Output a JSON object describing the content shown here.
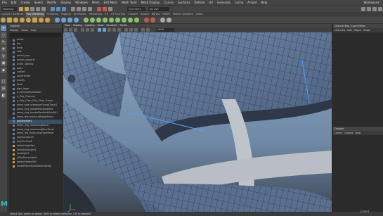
{
  "menubar": {
    "items": [
      "File",
      "Edit",
      "Create",
      "Select",
      "Modify",
      "Display",
      "Windows",
      "Mesh",
      "Edit Mesh",
      "Mesh Tools",
      "Mesh Display",
      "Curves",
      "Surfaces",
      "Deform",
      "UV",
      "Generate",
      "Cache",
      "Arnold",
      "Help"
    ],
    "workspace": "Workspace :"
  },
  "status": {
    "mode": "Modeling",
    "symmetry": "Symmetry: Off",
    "live": "No Live Surface"
  },
  "shelf": {
    "tabs": [
      "Curves / Surfaces",
      "Poly Modeling",
      "Sculpting",
      "Rigging",
      "Animation",
      "Rendering",
      "FX",
      "FX Caching",
      "Custom",
      "Arnold",
      "Bifrost",
      "MASH",
      "Motion Graphics",
      "XGen"
    ],
    "active_tab": "Poly Modeling"
  },
  "outliner": {
    "title": "Outliner",
    "menu": [
      "Display",
      "Show",
      "Help"
    ],
    "items": [
      {
        "label": "persp",
        "sel": false
      },
      {
        "label": "top",
        "sel": false
      },
      {
        "label": "front",
        "sel": false
      },
      {
        "label": "side",
        "sel": false
      },
      {
        "label": "portal_tops",
        "sel": false
      },
      {
        "label": "portal_supports",
        "sel": false
      },
      {
        "label": "plinth_lighting",
        "sel": false
      },
      {
        "label": "body",
        "sel": false
      },
      {
        "label": "cabled",
        "sel": false
      },
      {
        "label": "plantHolder",
        "sel": false
      },
      {
        "label": "leaves",
        "sel": false
      },
      {
        "label": "base",
        "sel": false
      },
      {
        "label": "pipe_large",
        "sel": false
      },
      {
        "label": "p_CircularPipeSet001",
        "sel": false
      },
      {
        "label": "p_Poly_Channel",
        "sel": false
      },
      {
        "label": "p_Poly_Chan_Poly_Chan_Frame",
        "sel": false
      },
      {
        "label": "bevel_pipe_outerpipeGroupGroup1",
        "sel": false
      },
      {
        "label": "bevel_ring_handleManifoldMain",
        "sel": false
      },
      {
        "label": "bevel_ring_handleManifoldMain001",
        "sel": false
      },
      {
        "label": "bevel_left_mouse_leftsideSmall",
        "sel": false
      },
      {
        "label": "polySurface1",
        "sel": true
      },
      {
        "label": "bevel_ring_measuringPanel",
        "sel": false
      },
      {
        "label": "bevel_ring_measuringRearPanel",
        "sel": false
      },
      {
        "label": "bevel_left_measuringFrontPanel",
        "sel": false
      },
      {
        "label": "polySurface19",
        "sel": false
      },
      {
        "label": "polySurface8",
        "sel": false
      },
      {
        "label": "defaultLightSet",
        "sel": false
      },
      {
        "label": "directionalLight1",
        "sel": false
      },
      {
        "label": "areaLight1",
        "sel": false
      },
      {
        "label": "aiSkyDomeLight1",
        "sel": false
      },
      {
        "label": "defaultObjectSet",
        "sel": false
      },
      {
        "label": "modelPanel4ViewSelectedSet",
        "sel": false
      }
    ]
  },
  "viewport": {
    "menu": [
      "View",
      "Shading",
      "Lighting",
      "Show",
      "Renderer",
      "Panels"
    ],
    "camera_field": "sRGB gamma"
  },
  "channelbox": {
    "tabs": "Channel Box / Layer Editor",
    "menu": [
      "Channels",
      "Edit",
      "Object",
      "Show"
    ],
    "layers_title": "Display",
    "layers_menu": [
      "Layers",
      "Options",
      "Help"
    ]
  },
  "helpline": {
    "text": "Select Tool: select an object. Shift to extend selection. Ctrl to deselect."
  },
  "watermark": "Linked"
}
